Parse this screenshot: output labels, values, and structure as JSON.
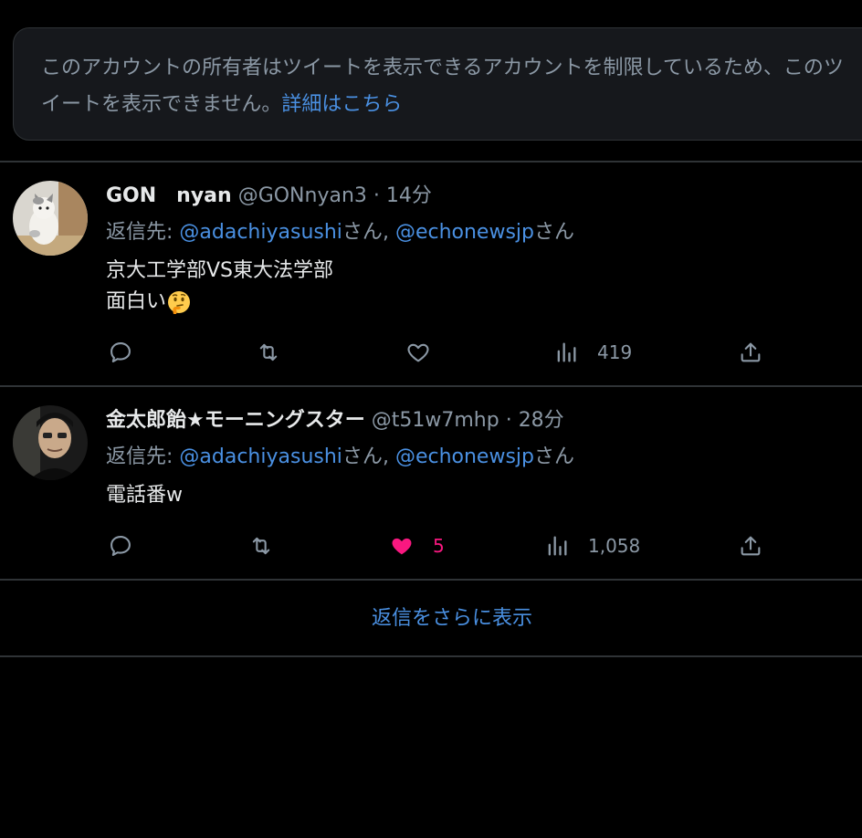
{
  "notice": {
    "text": "このアカウントの所有者はツイートを表示できるアカウントを制限しているため、このツイートを表示できません。",
    "link": "詳細はこちら"
  },
  "tweets": [
    {
      "display_name": "GON　nyan",
      "handle": "@GONnyan3",
      "separator": "·",
      "time": "14分",
      "reply_prefix": "返信先: ",
      "reply_mentions": [
        "@adachiyasushi",
        "@echonewsjp"
      ],
      "reply_suffix": "さん",
      "reply_joiner": ", ",
      "content_lines": [
        "京大工学部VS東大法学部",
        "面白い"
      ],
      "emoji": "thinking-face",
      "like_count": "",
      "view_count": "419"
    },
    {
      "display_name": "金太郎飴★モーニングスター",
      "handle": "@t51w7mhp",
      "separator": "·",
      "time": "28分",
      "reply_prefix": "返信先: ",
      "reply_mentions": [
        "@adachiyasushi",
        "@echonewsjp"
      ],
      "reply_suffix": "さん",
      "reply_joiner": ", ",
      "content_lines": [
        "電話番w"
      ],
      "like_count": "5",
      "view_count": "1,058"
    }
  ],
  "show_more": "返信をさらに表示",
  "colors": {
    "background": "#000000",
    "accent_link": "#4a90e2",
    "like_active": "#f91880",
    "muted_text": "#8b98a5"
  },
  "icons": [
    "reply-icon",
    "retweet-icon",
    "like-icon",
    "views-icon",
    "share-icon"
  ]
}
